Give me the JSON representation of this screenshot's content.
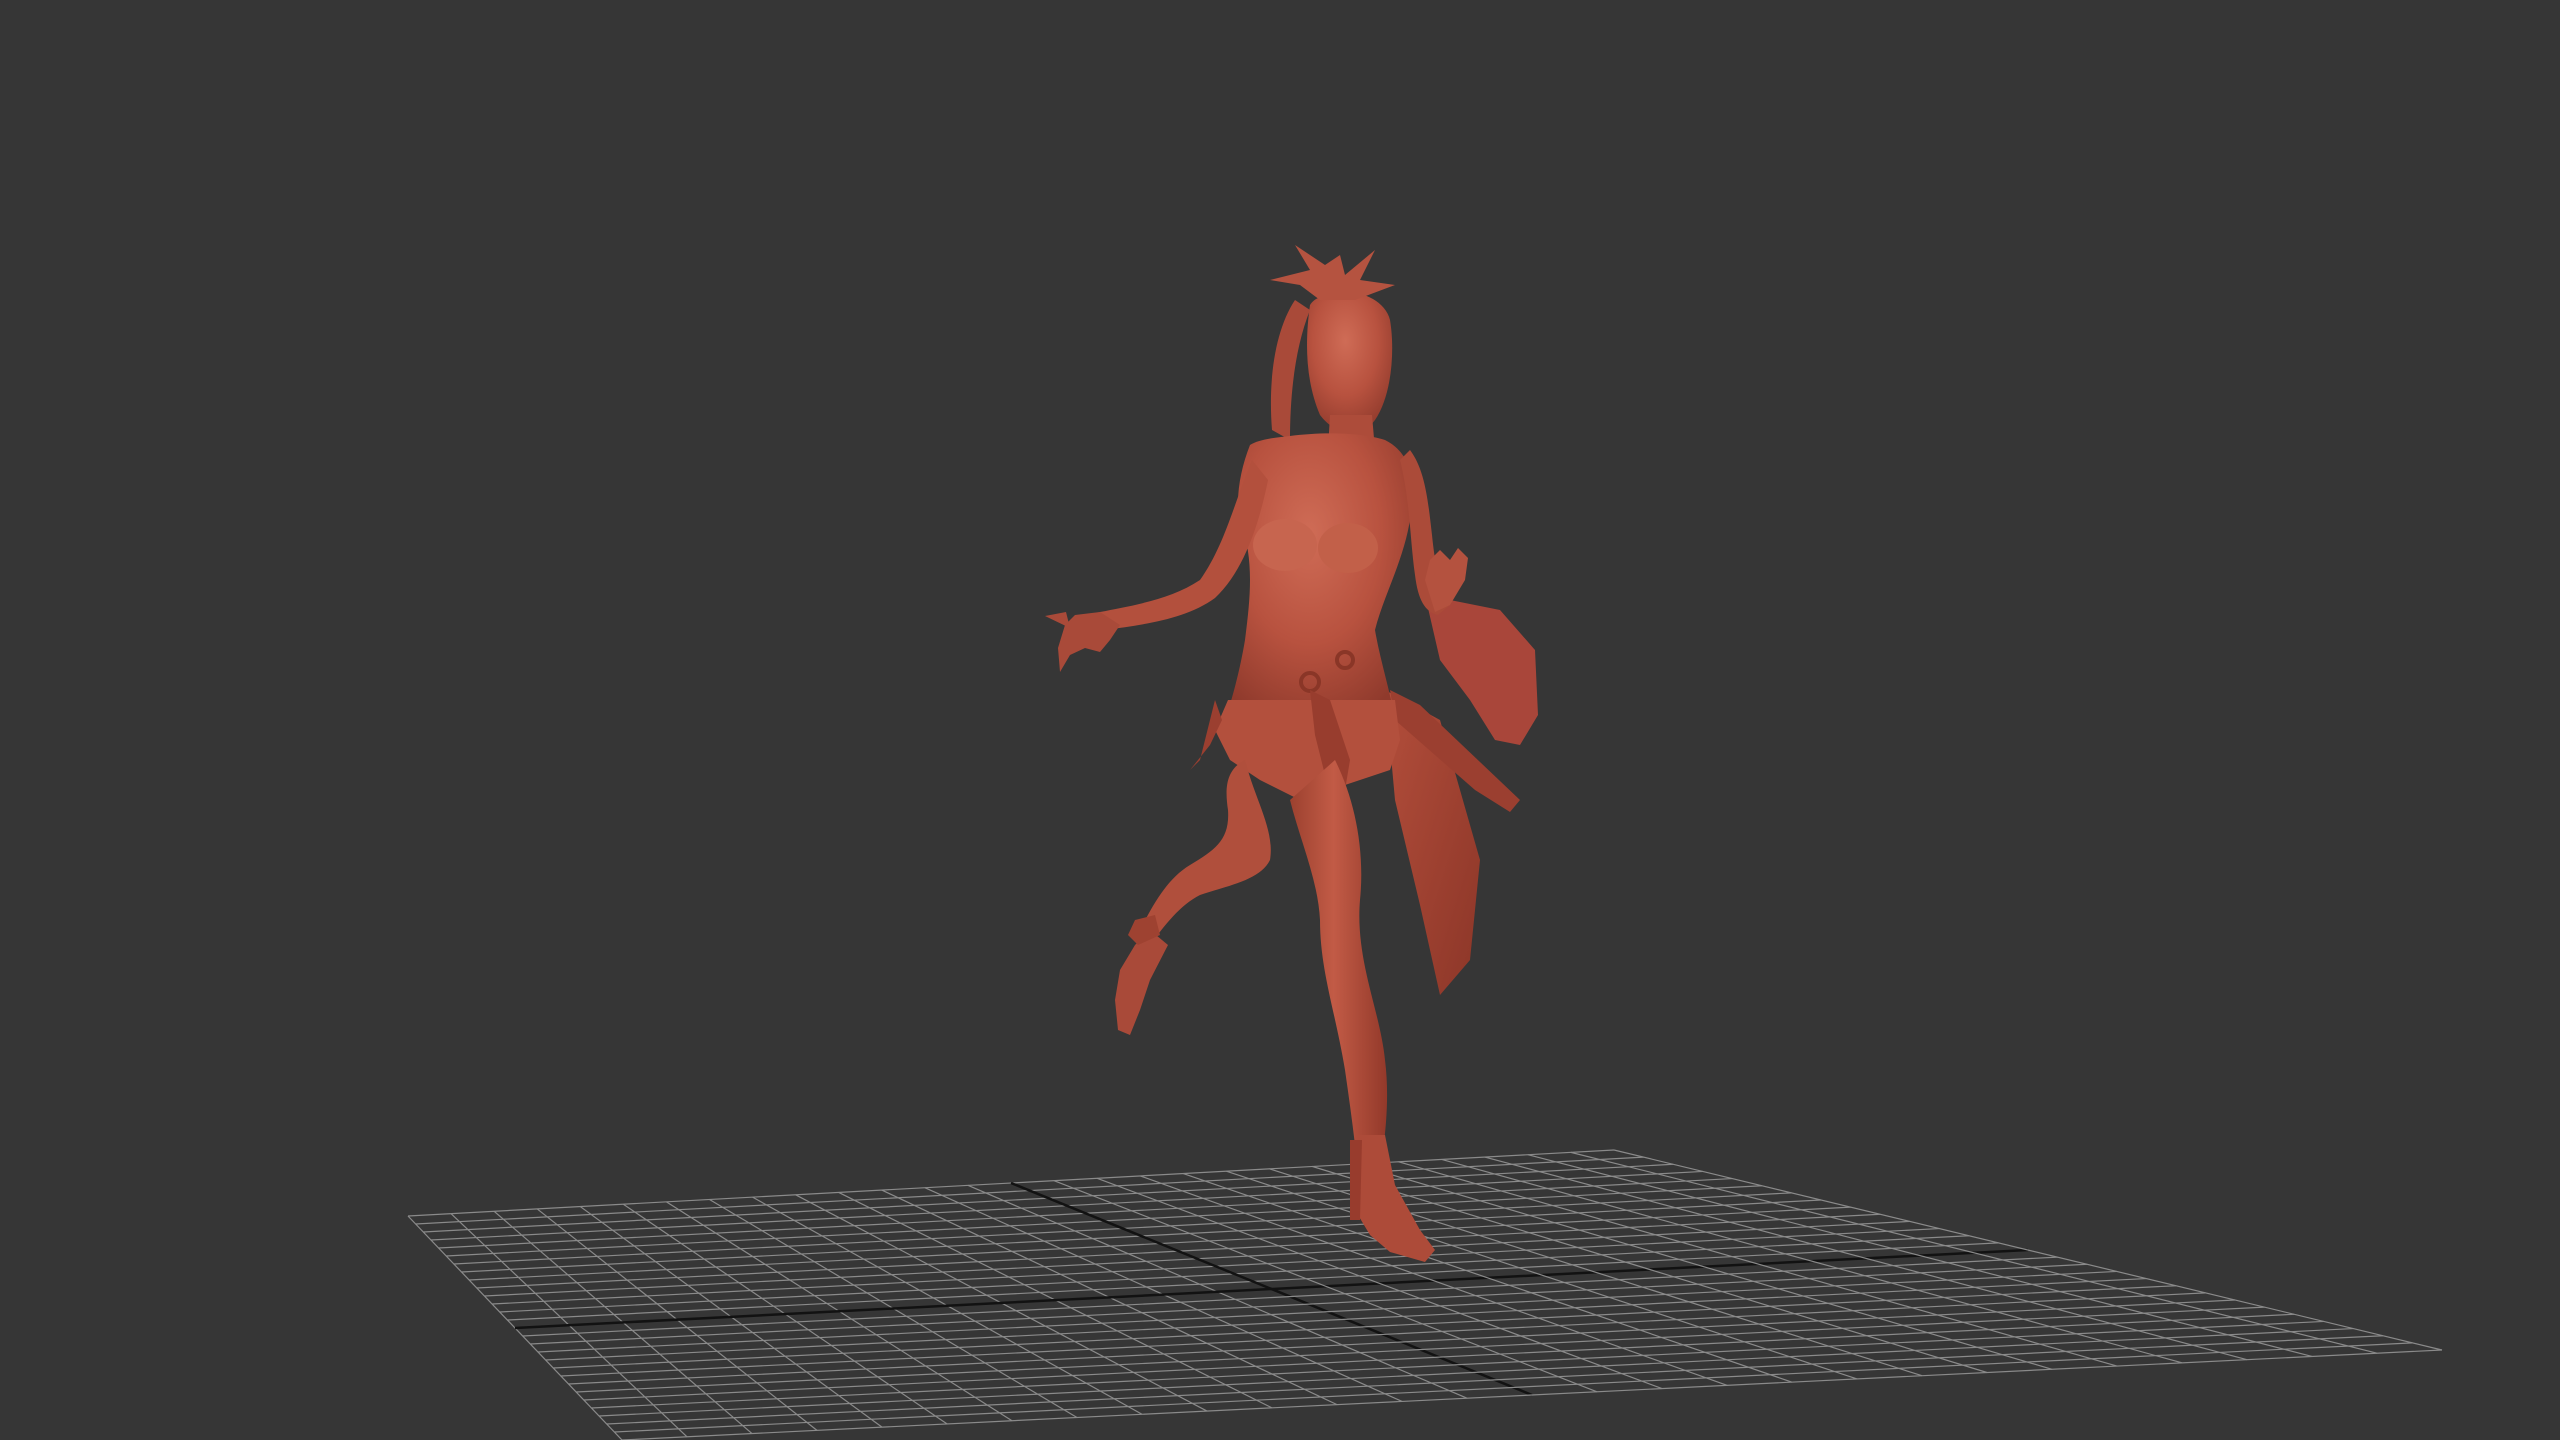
{
  "viewport": {
    "background_color": "#363636",
    "grid_color": "#8a8a8a",
    "grid_axis_color": "#121212",
    "model_color": "#b8523f",
    "model_highlight_color": "#c96a55",
    "model_shadow_color": "#8f3a2c",
    "grid_divisions": 28,
    "shading_mode": "clay"
  }
}
